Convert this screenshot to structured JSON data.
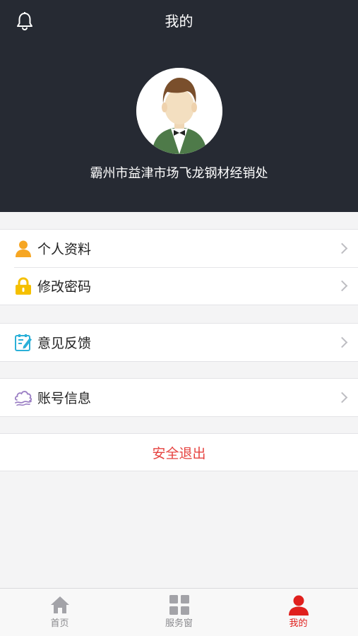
{
  "header": {
    "title": "我的",
    "bell_icon": "bell-icon",
    "avatar_icon": "user-avatar-illustration",
    "company_name": "霸州市益津市场飞龙钢材经销处"
  },
  "menu": {
    "group1": [
      {
        "label": "个人资料",
        "icon": "person-icon"
      },
      {
        "label": "修改密码",
        "icon": "lock-icon"
      }
    ],
    "group2": [
      {
        "label": "意见反馈",
        "icon": "feedback-edit-icon"
      }
    ],
    "group3": [
      {
        "label": "账号信息",
        "icon": "cloud-info-icon"
      }
    ],
    "logout_label": "安全退出"
  },
  "tabbar": {
    "items": [
      {
        "label": "首页",
        "icon": "home-icon",
        "active": false
      },
      {
        "label": "服务窗",
        "icon": "grid-icon",
        "active": false
      },
      {
        "label": "我的",
        "icon": "person-icon",
        "active": true
      }
    ]
  },
  "colors": {
    "header_bg": "#262a33",
    "accent_red": "#e0201d",
    "logout_red": "#e64340",
    "page_bg": "#f4f4f5"
  }
}
